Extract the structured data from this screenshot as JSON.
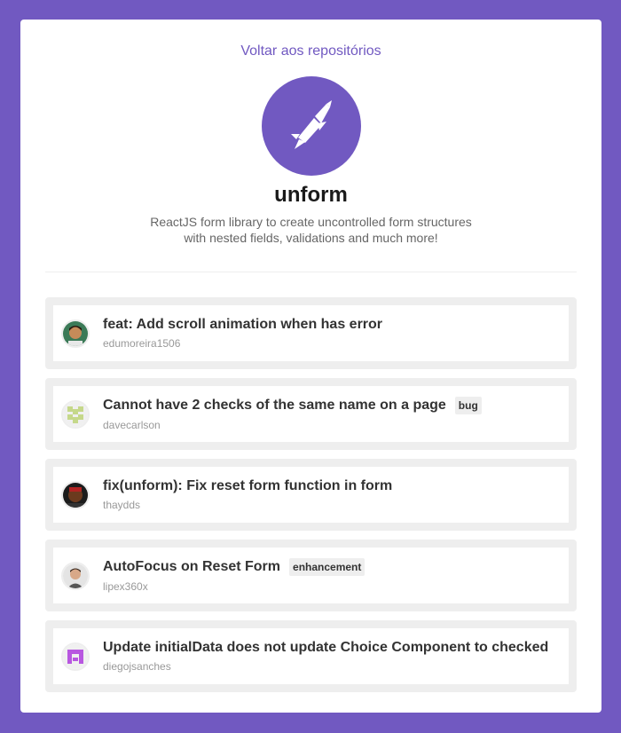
{
  "header": {
    "back_link": "Voltar aos repositórios"
  },
  "repo": {
    "name": "unform",
    "description": "ReactJS form library to create uncontrolled form structures with nested fields, validations and much more!",
    "logo_icon": "rocket-icon"
  },
  "colors": {
    "brand": "#7159c1",
    "background": "#7159c1",
    "card": "#ffffff",
    "issue_border": "#eeeeee"
  },
  "issues": [
    {
      "title": "feat: Add scroll animation when has error",
      "author": "edumoreira1506",
      "label": "",
      "avatar": "photo-avatar"
    },
    {
      "title": "Cannot have 2 checks of the same name on a page",
      "author": "davecarlson",
      "label": "bug",
      "avatar": "identicon-avatar"
    },
    {
      "title": "fix(unform): Fix reset form function in form",
      "author": "thaydds",
      "label": "",
      "avatar": "photo-avatar"
    },
    {
      "title": "AutoFocus on Reset Form",
      "author": "lipex360x",
      "label": "enhancement",
      "avatar": "photo-avatar"
    },
    {
      "title": "Update initialData does not update Choice Component to checked",
      "author": "diegojsanches",
      "label": "",
      "avatar": "identicon-avatar"
    }
  ]
}
